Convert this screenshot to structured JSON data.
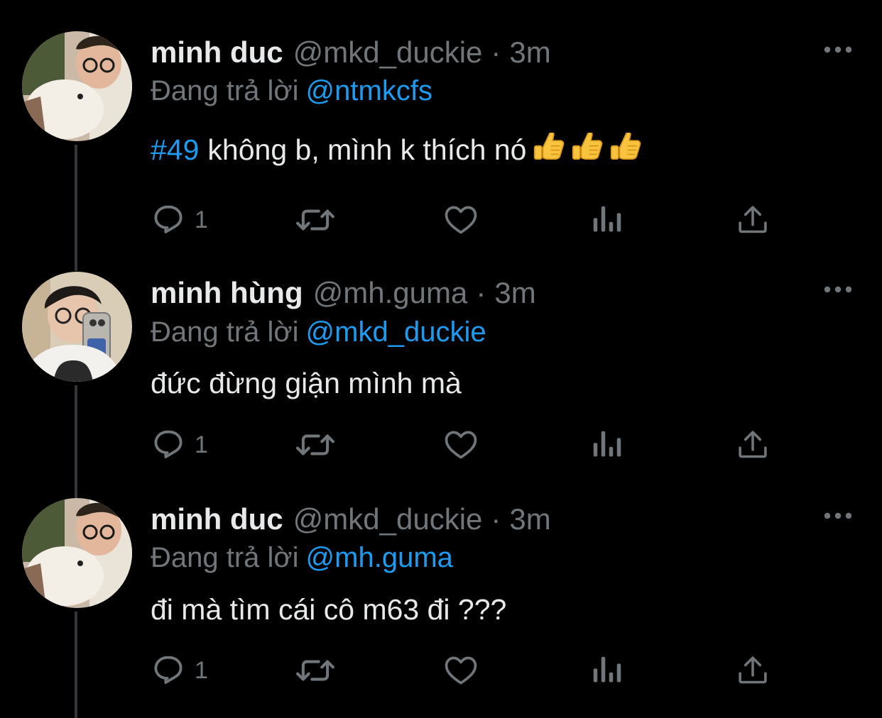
{
  "tweets": [
    {
      "name": "minh duc",
      "handle": "@mkd_duckie",
      "separator": "·",
      "time": "3m",
      "reply_prefix": "Đang trả lời",
      "reply_to": "@ntmkcfs",
      "hashtag": "#49",
      "text": "không b, mình k thích nó",
      "emoji": [
        "thumbs-up",
        "thumbs-up",
        "thumbs-up"
      ],
      "reply_count": "1"
    },
    {
      "name": "minh hùng",
      "handle": "@mh.guma",
      "separator": "·",
      "time": "3m",
      "reply_prefix": "Đang trả lời",
      "reply_to": "@mkd_duckie",
      "text": "đức đừng giận mình mà",
      "reply_count": "1"
    },
    {
      "name": "minh duc",
      "handle": "@mkd_duckie",
      "separator": "·",
      "time": "3m",
      "reply_prefix": "Đang trả lời",
      "reply_to": "@mh.guma",
      "text": "đi mà tìm cái cô m63 đi ???",
      "reply_count": "1"
    }
  ],
  "icons": [
    "more-icon",
    "reply-icon",
    "retweet-icon",
    "like-icon",
    "views-icon",
    "share-icon"
  ],
  "colors": {
    "background": "#000000",
    "text": "#e7e9ea",
    "muted": "#71767b",
    "accent": "#1d9bf0",
    "thread_line": "#333639"
  }
}
